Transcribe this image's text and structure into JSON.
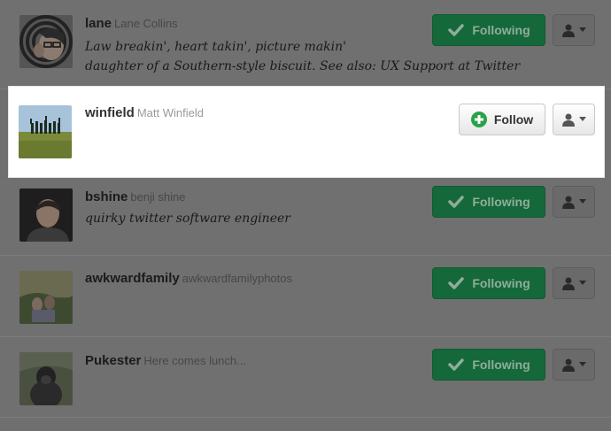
{
  "users": [
    {
      "username": "lane",
      "display_name": "Lane Collins",
      "bio_lines": [
        "Law breakin', heart takin', picture makin'",
        "daughter of a Southern-style biscuit. See also: UX Support at Twitter"
      ],
      "button_label": "Following"
    },
    {
      "username": "winfield",
      "display_name": "Matt Winfield",
      "bio_lines": [],
      "button_label": "Follow"
    },
    {
      "username": "bshine",
      "display_name": "benji shine",
      "bio_lines": [
        "quirky twitter software engineer"
      ],
      "button_label": "Following"
    },
    {
      "username": "awkwardfamily",
      "display_name": "awkwardfamilyphotos",
      "bio_lines": [],
      "button_label": "Following"
    },
    {
      "username": "Pukester",
      "display_name": "Here comes lunch...",
      "bio_lines": [],
      "button_label": "Following"
    }
  ],
  "icons": {
    "following": "check-icon",
    "follow": "plus-circle-icon",
    "user_menu": "user-dropdown-icon"
  },
  "colors": {
    "following_button": "#15683a",
    "follow_plus": "#29a24b",
    "overlay": "#6f6f6f",
    "highlight_row": "#ffffff"
  }
}
